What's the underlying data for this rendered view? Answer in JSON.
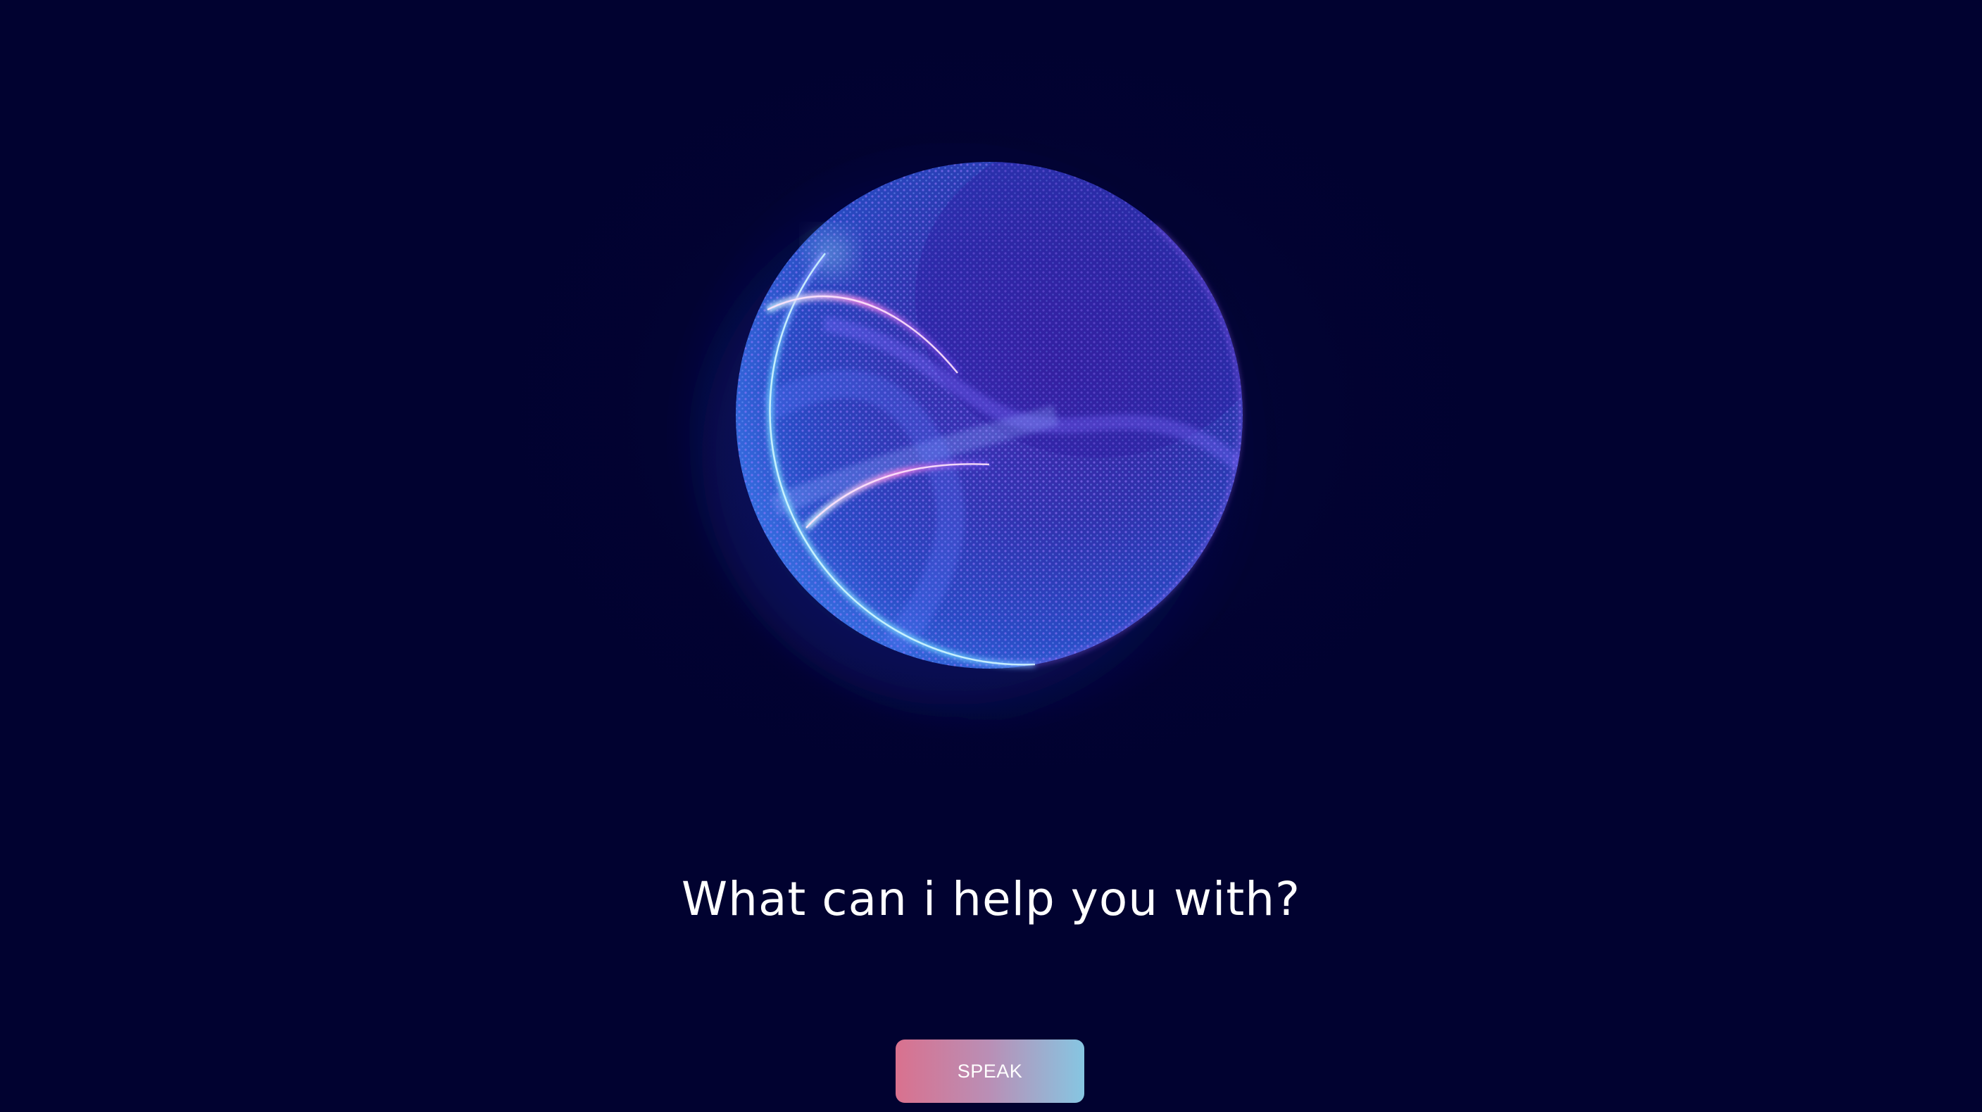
{
  "assistant": {
    "prompt_text": "What can i help you with?",
    "speak_label": "SPEAK",
    "orb_icon": "particle-sphere-icon"
  },
  "colors": {
    "background": "#010230",
    "orb_core": "#3c3fc4",
    "orb_edge_violet": "#b866ff",
    "orb_edge_cyan": "#8ef0ff",
    "orb_highlight_pink": "#ff7adf",
    "button_gradient_start": "#d9718e",
    "button_gradient_end": "#86c6e2",
    "text": "#ffffff"
  }
}
